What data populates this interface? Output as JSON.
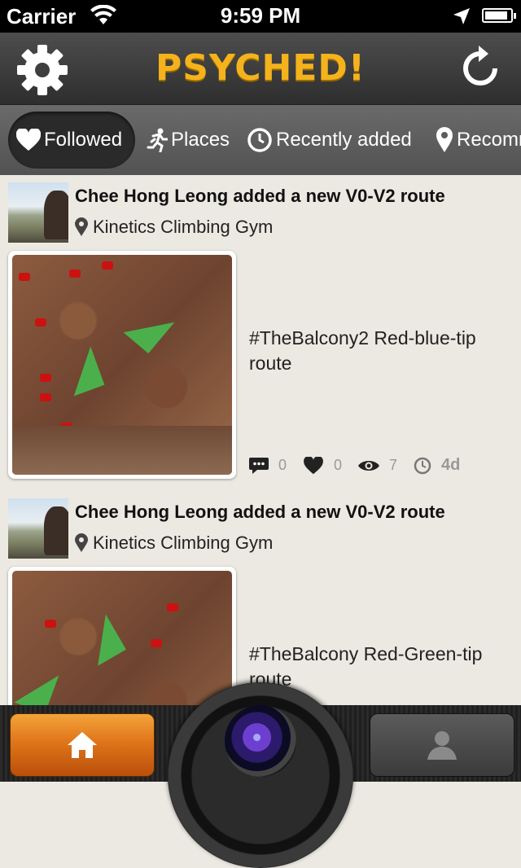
{
  "status_bar": {
    "carrier": "Carrier",
    "time": "9:59 PM",
    "battery_level": 0.9
  },
  "header": {
    "title": "PSYCHED!",
    "left_icon": "gear-icon",
    "right_icon": "refresh-icon"
  },
  "tabs": [
    {
      "label": "Followed",
      "icon": "heart-icon",
      "active": true
    },
    {
      "label": "Places",
      "icon": "runner-icon",
      "active": false
    },
    {
      "label": "Recently added",
      "icon": "clock-icon",
      "active": false
    },
    {
      "label": "Recomm",
      "icon": "location-pin-icon",
      "active": false
    }
  ],
  "feed": [
    {
      "title": "Chee Hong Leong added a new V0-V2 route",
      "location": "Kinetics Climbing Gym",
      "description": "#TheBalcony2 Red-blue-tip route",
      "comments": "0",
      "likes": "0",
      "views": "7",
      "age": "4d"
    },
    {
      "title": "Chee Hong Leong added a new V0-V2 route",
      "location": "Kinetics Climbing Gym",
      "description": "#TheBalcony Red-Green-tip route"
    }
  ],
  "bottom_bar": {
    "home_icon": "home-icon",
    "camera_icon": "camera-lens-icon",
    "profile_icon": "person-icon"
  },
  "colors": {
    "accent": "#f4b31c",
    "home_button": "#e0751a"
  }
}
